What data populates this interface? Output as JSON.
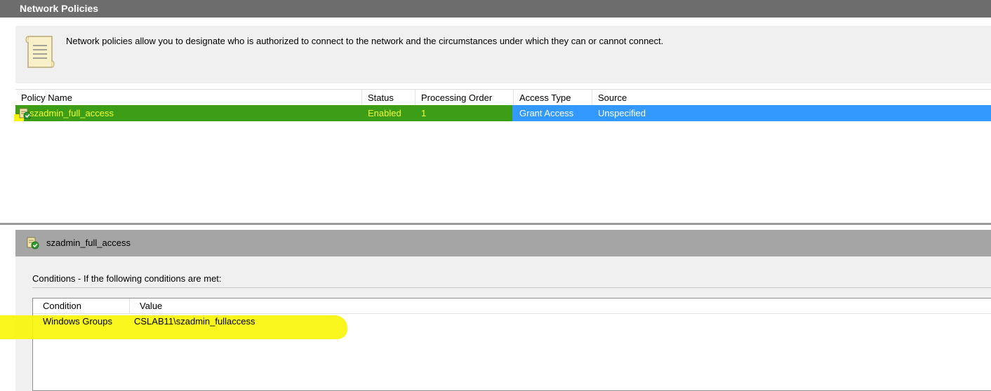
{
  "window": {
    "title": "Network Policies"
  },
  "description": {
    "text": "Network policies allow you to designate who is authorized to connect to the network and the circumstances under which they can or cannot connect.",
    "icon": "document-icon"
  },
  "policies": {
    "columns": [
      "Policy Name",
      "Status",
      "Processing Order",
      "Access Type",
      "Source"
    ],
    "rows": [
      {
        "name": "szadmin_full_access",
        "status": "Enabled",
        "order": "1",
        "access_type": "Grant Access",
        "source": "Unspecified",
        "selected": true,
        "icon": "policy-enabled-icon"
      }
    ]
  },
  "detail": {
    "title": "szadmin_full_access",
    "icon": "policy-enabled-icon",
    "conditions_label": "Conditions - If the following conditions are met:",
    "columns": [
      "Condition",
      "Value"
    ],
    "rows": [
      {
        "condition": "Windows Groups",
        "value": "CSLAB11\\szadmin_fullaccess"
      }
    ]
  },
  "colors": {
    "title_bar": "#6d6d6d",
    "selection": "#3399ff",
    "green_highlight": "#3c9d17",
    "yellow_highlight": "#f7f50a"
  }
}
